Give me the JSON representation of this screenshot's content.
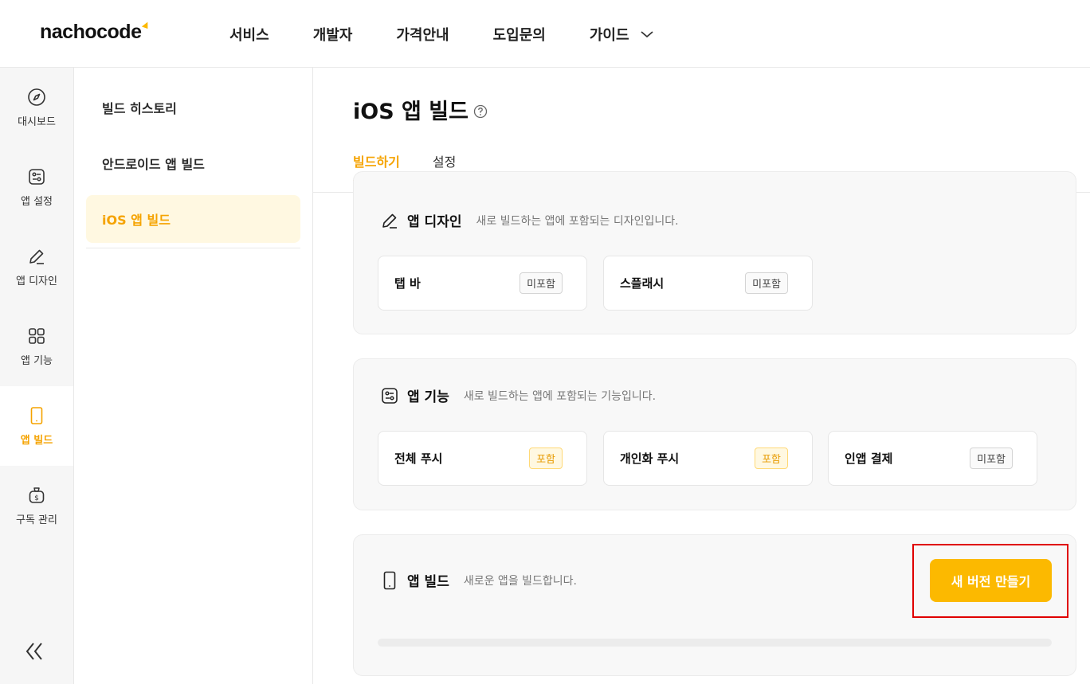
{
  "header": {
    "logo": "nachocode",
    "nav": [
      {
        "label": "서비스"
      },
      {
        "label": "개발자"
      },
      {
        "label": "가격안내"
      },
      {
        "label": "도입문의"
      },
      {
        "label": "가이드"
      }
    ]
  },
  "rail": {
    "items": [
      {
        "label": "대시보드",
        "icon": "compass-icon"
      },
      {
        "label": "앱 설정",
        "icon": "settings-toggle-icon"
      },
      {
        "label": "앱 디자인",
        "icon": "pen-icon"
      },
      {
        "label": "앱 기능",
        "icon": "grid-icon"
      },
      {
        "label": "앱 빌드",
        "icon": "phone-icon",
        "active": true
      },
      {
        "label": "구독 관리",
        "icon": "money-bag-icon"
      }
    ],
    "collapse_icon": "double-chevron-left-icon"
  },
  "subnav": {
    "items": [
      {
        "label": "빌드 히스토리"
      },
      {
        "label": "안드로이드 앱 빌드"
      },
      {
        "label": "iOS 앱 빌드",
        "active": true
      }
    ]
  },
  "main": {
    "title": "iOS 앱 빌드",
    "tabs": [
      {
        "label": "빌드하기",
        "active": true
      },
      {
        "label": "설정"
      }
    ],
    "design": {
      "title": "앱 디자인",
      "desc": "새로 빌드하는 앱에 포함되는 디자인입니다.",
      "cards": [
        {
          "name": "탭 바",
          "status": "미포함"
        },
        {
          "name": "스플래시",
          "status": "미포함"
        }
      ]
    },
    "features": {
      "title": "앱 기능",
      "desc": "새로 빌드하는 앱에 포함되는 기능입니다.",
      "cards": [
        {
          "name": "전체 푸시",
          "status": "포함"
        },
        {
          "name": "개인화 푸시",
          "status": "포함"
        },
        {
          "name": "인앱 결제",
          "status": "미포함"
        }
      ]
    },
    "build": {
      "title": "앱 빌드",
      "desc": "새로운 앱을 빌드합니다.",
      "button": "새 버전 만들기",
      "progress": 0
    }
  },
  "colors": {
    "accent": "#fcb900",
    "accent_text": "#f5a300",
    "highlight": "#e00000"
  }
}
